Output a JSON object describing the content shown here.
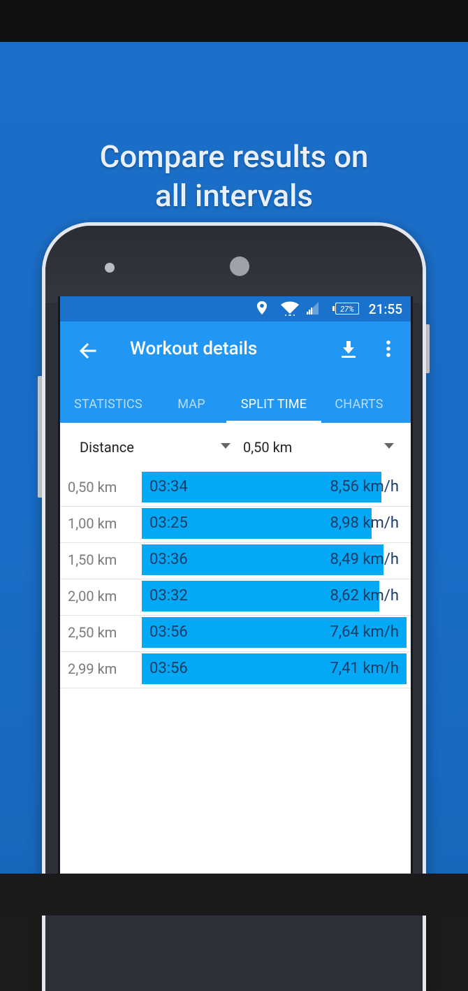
{
  "promo": {
    "headline_line1": "Compare results on",
    "headline_line2": "all intervals",
    "background_color": "#1b6fc9"
  },
  "status_bar": {
    "battery": "27%",
    "time": "21:55",
    "icons": [
      "location-icon",
      "wifi-icon",
      "signal-icon",
      "battery-icon"
    ]
  },
  "app_bar": {
    "title": "Workout details",
    "back_icon": "arrow-left-icon",
    "download_icon": "download-icon",
    "more_icon": "more-vert-icon",
    "color": "#2196f3"
  },
  "tabs": [
    {
      "label": "STATISTICS",
      "active": false
    },
    {
      "label": "MAP",
      "active": false
    },
    {
      "label": "SPLIT TIME",
      "active": true
    },
    {
      "label": "CHARTS",
      "active": false
    }
  ],
  "filter": {
    "type_label": "Distance",
    "interval_value": "0,50 km"
  },
  "splits": {
    "bar_color": "#03a9f4",
    "rows": [
      {
        "distance": "0,50 km",
        "time": "03:34",
        "speed": "8,56 km/h",
        "relative_length": 0.905
      },
      {
        "distance": "1,00 km",
        "time": "03:25",
        "speed": "8,98 km/h",
        "relative_length": 0.867
      },
      {
        "distance": "1,50 km",
        "time": "03:36",
        "speed": "8,49 km/h",
        "relative_length": 0.914
      },
      {
        "distance": "2,00 km",
        "time": "03:32",
        "speed": "8,62 km/h",
        "relative_length": 0.898
      },
      {
        "distance": "2,50 km",
        "time": "03:56",
        "speed": "7,64 km/h",
        "relative_length": 1.0
      },
      {
        "distance": "2,99 km",
        "time": "03:56",
        "speed": "7,41 km/h",
        "relative_length": 1.0
      }
    ]
  }
}
